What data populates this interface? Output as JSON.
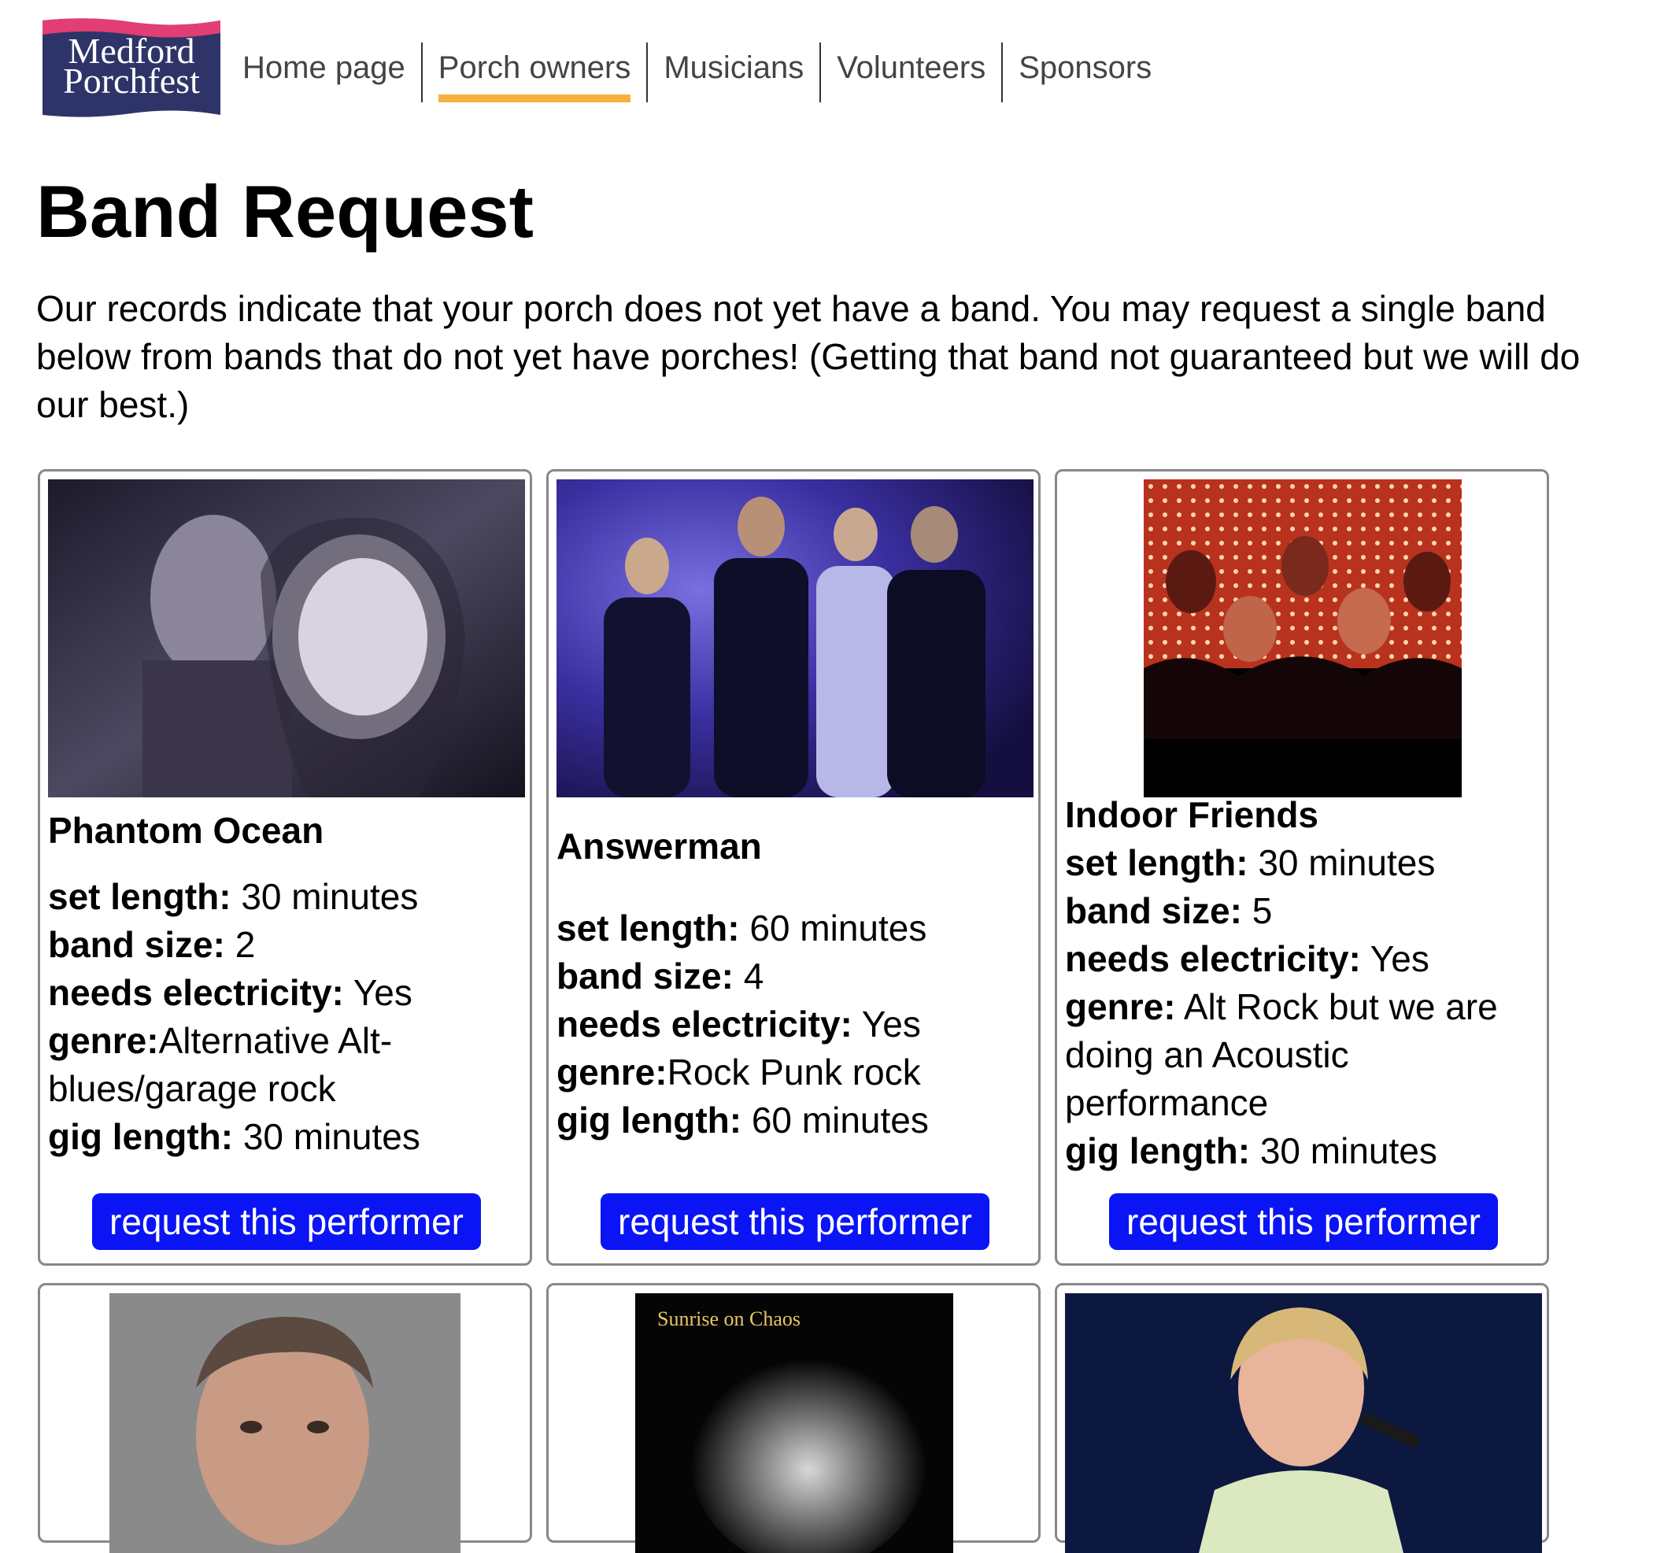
{
  "logo": {
    "line1": "Medford",
    "line2": "Porchfest"
  },
  "nav": {
    "items": [
      {
        "label": "Home page"
      },
      {
        "label": "Porch owners"
      },
      {
        "label": "Musicians"
      },
      {
        "label": "Volunteers"
      },
      {
        "label": "Sponsors"
      }
    ],
    "active": "Porch owners"
  },
  "page": {
    "title": "Band Request",
    "intro": "Our records indicate that your porch does not yet have a band. You may request a single band below from bands that do not yet have porches! (Getting that band not guaranteed but we will do our best.)"
  },
  "labels": {
    "set_length": "set length:",
    "band_size": "band size:",
    "needs_electricity": "needs electricity:",
    "genre": "genre:",
    "gig_length": "gig length:"
  },
  "bands": [
    {
      "name": "Phantom Ocean",
      "set_length": "30 minutes",
      "band_size": "2",
      "needs_electricity": "Yes",
      "genre": "Alternative Alt-blues/garage rock",
      "gig_length": "30 minutes",
      "button": "request this performer"
    },
    {
      "name": "Answerman",
      "set_length": "60 minutes",
      "band_size": "4",
      "needs_electricity": "Yes",
      "genre": "Rock Punk rock",
      "gig_length": "60 minutes",
      "button": "request this performer"
    },
    {
      "name": "Indoor Friends",
      "set_length": "30 minutes",
      "band_size": "5",
      "needs_electricity": "Yes",
      "genre": "Alt Rock but we are doing an Acoustic performance",
      "gig_length": "30 minutes",
      "button": "request this performer"
    }
  ],
  "partial_cards": [
    {
      "photo_text": ""
    },
    {
      "photo_text": "Sunrise on Chaos"
    },
    {
      "photo_text": ""
    }
  ],
  "colors": {
    "logo_navy": "#2e3468",
    "logo_pink": "#e23d74",
    "nav_underline": "#f8b03f",
    "button_blue": "#0b14f5",
    "card_border": "#888888"
  }
}
